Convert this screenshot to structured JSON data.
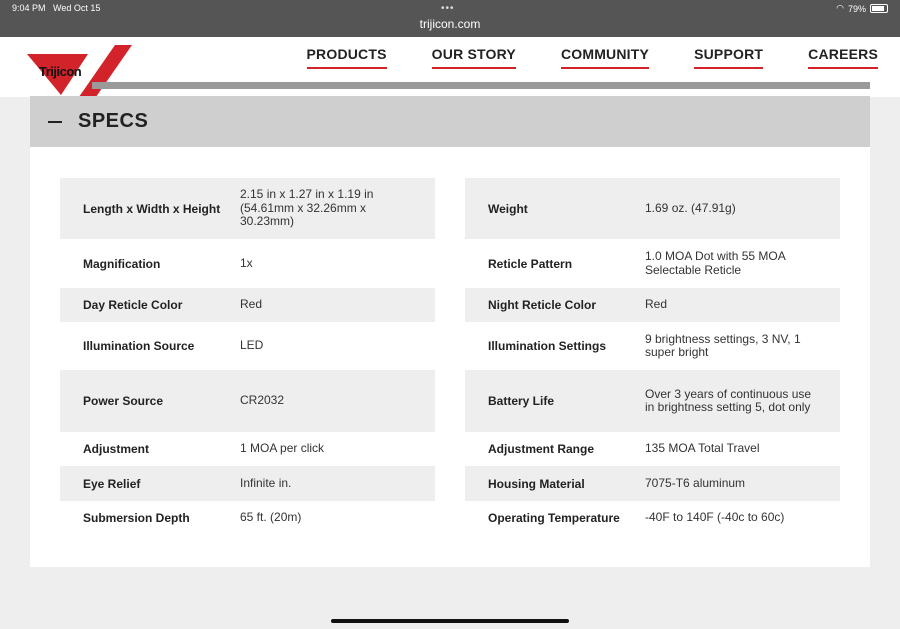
{
  "status": {
    "time": "9:04 PM",
    "date": "Wed Oct 15",
    "url": "trijicon.com",
    "battery": "79%",
    "wifi_icon": "wifi-icon",
    "battery_icon": "battery-icon"
  },
  "brand": {
    "logo_text": "Trijicon",
    "accent": "#d2232a"
  },
  "nav": {
    "items": [
      "PRODUCTS",
      "OUR STORY",
      "COMMUNITY",
      "SUPPORT",
      "CAREERS"
    ]
  },
  "specs": {
    "title": "SPECS",
    "left": [
      {
        "label": "Length x Width x Height",
        "value": "2.15 in x 1.27 in x 1.19 in (54.61mm x 32.26mm x 30.23mm)"
      },
      {
        "label": "Magnification",
        "value": "1x"
      },
      {
        "label": "Day Reticle Color",
        "value": "Red"
      },
      {
        "label": "Illumination Source",
        "value": "LED"
      },
      {
        "label": "Power Source",
        "value": "CR2032"
      },
      {
        "label": "Adjustment",
        "value": "1 MOA per click"
      },
      {
        "label": "Eye Relief",
        "value": "Infinite in."
      },
      {
        "label": "Submersion Depth",
        "value": "65 ft. (20m)"
      }
    ],
    "right": [
      {
        "label": "Weight",
        "value": "1.69 oz. (47.91g)"
      },
      {
        "label": "Reticle Pattern",
        "value": "1.0 MOA Dot with 55 MOA Selectable Reticle"
      },
      {
        "label": "Night Reticle Color",
        "value": "Red"
      },
      {
        "label": "Illumination Settings",
        "value": "9 brightness settings, 3 NV, 1 super bright"
      },
      {
        "label": "Battery Life",
        "value": "Over 3 years of continuous use in brightness setting 5, dot only"
      },
      {
        "label": "Adjustment Range",
        "value": "135 MOA Total Travel"
      },
      {
        "label": "Housing Material",
        "value": "7075-T6 aluminum"
      },
      {
        "label": "Operating Temperature",
        "value": "-40F to 140F (-40c to 60c)"
      }
    ]
  }
}
